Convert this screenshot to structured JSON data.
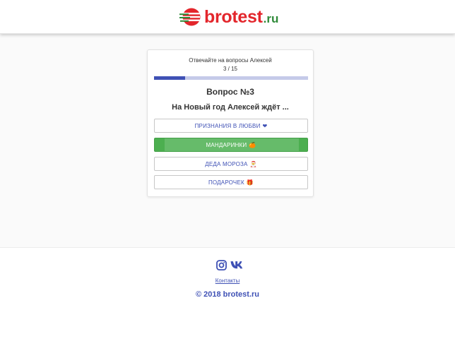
{
  "header": {
    "logo_icon": "brotest-logo-icon",
    "logo_text": "brotest",
    "logo_tld": ".ru",
    "brand_red": "#e3262c",
    "brand_green": "#2e8a38"
  },
  "quiz": {
    "subtitle": "Отвечайте на вопросы Алексей",
    "counter": "3 / 15",
    "progress_fraction": 0.2,
    "question_number": "Вопрос №3",
    "question_text": "На Новый год Алексей ждёт ...",
    "accent_color": "#3f51b5",
    "answers": [
      {
        "label": "ПРИЗНАНИЯ В ЛЮБВИ",
        "emoji": "❤",
        "selected": false
      },
      {
        "label": "МАНДАРИНКИ",
        "emoji": "🍊",
        "selected": true
      },
      {
        "label": "ДЕДА МОРОЗА",
        "emoji": "🎅",
        "selected": false
      },
      {
        "label": "ПОДАРОЧЕК",
        "emoji": "🎁",
        "selected": false
      }
    ],
    "selected_color": "#4caf50"
  },
  "footer": {
    "social_icons": [
      "instagram-icon",
      "vk-icon"
    ],
    "contacts_label": "Контакты",
    "copyright": "© 2018 brotest.ru"
  }
}
